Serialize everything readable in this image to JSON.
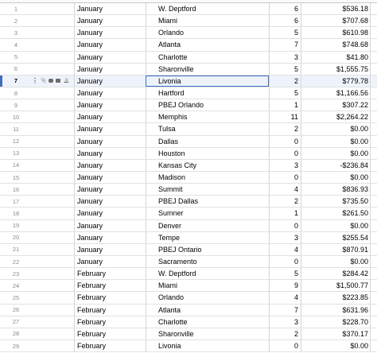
{
  "selected_row": 7,
  "rows": [
    {
      "n": "1",
      "month": "January",
      "city": "W. Deptford",
      "count": "6",
      "amount": "$536.18"
    },
    {
      "n": "2",
      "month": "January",
      "city": "Miami",
      "count": "6",
      "amount": "$707.68"
    },
    {
      "n": "3",
      "month": "January",
      "city": "Orlando",
      "count": "5",
      "amount": "$610.98"
    },
    {
      "n": "4",
      "month": "January",
      "city": "Atlanta",
      "count": "7",
      "amount": "$748.68"
    },
    {
      "n": "5",
      "month": "January",
      "city": "Charlotte",
      "count": "3",
      "amount": "$41.80"
    },
    {
      "n": "6",
      "month": "January",
      "city": "Sharonville",
      "count": "5",
      "amount": "$1,555.75"
    },
    {
      "n": "7",
      "month": "January",
      "city": "Livonia",
      "count": "2",
      "amount": "$779.78"
    },
    {
      "n": "8",
      "month": "January",
      "city": "Hartford",
      "count": "5",
      "amount": "$1,166.56"
    },
    {
      "n": "9",
      "month": "January",
      "city": "PBEJ Orlando",
      "count": "1",
      "amount": "$307.22"
    },
    {
      "n": "10",
      "month": "January",
      "city": "Memphis",
      "count": "11",
      "amount": "$2,264.22"
    },
    {
      "n": "11",
      "month": "January",
      "city": "Tulsa",
      "count": "2",
      "amount": "$0.00"
    },
    {
      "n": "12",
      "month": "January",
      "city": "Dallas",
      "count": "0",
      "amount": "$0.00"
    },
    {
      "n": "13",
      "month": "January",
      "city": "Houston",
      "count": "0",
      "amount": "$0.00"
    },
    {
      "n": "14",
      "month": "January",
      "city": "Kansas City",
      "count": "3",
      "amount": "-$236.84"
    },
    {
      "n": "15",
      "month": "January",
      "city": "Madison",
      "count": "0",
      "amount": "$0.00"
    },
    {
      "n": "16",
      "month": "January",
      "city": "Summit",
      "count": "4",
      "amount": "$836.93"
    },
    {
      "n": "17",
      "month": "January",
      "city": "PBEJ Dallas",
      "count": "2",
      "amount": "$735.50"
    },
    {
      "n": "18",
      "month": "January",
      "city": "Sumner",
      "count": "1",
      "amount": "$261.50"
    },
    {
      "n": "19",
      "month": "January",
      "city": "Denver",
      "count": "0",
      "amount": "$0.00"
    },
    {
      "n": "20",
      "month": "January",
      "city": "Tempe",
      "count": "3",
      "amount": "$255.54"
    },
    {
      "n": "21",
      "month": "January",
      "city": "PBEJ Ontario",
      "count": "4",
      "amount": "$870.91"
    },
    {
      "n": "22",
      "month": "January",
      "city": "Sacramento",
      "count": "0",
      "amount": "$0.00"
    },
    {
      "n": "23",
      "month": "February",
      "city": "W. Deptford",
      "count": "5",
      "amount": "$284.42"
    },
    {
      "n": "24",
      "month": "February",
      "city": "Miami",
      "count": "9",
      "amount": "$1,500.77"
    },
    {
      "n": "25",
      "month": "February",
      "city": "Orlando",
      "count": "4",
      "amount": "$223.85"
    },
    {
      "n": "26",
      "month": "February",
      "city": "Atlanta",
      "count": "7",
      "amount": "$631.96"
    },
    {
      "n": "27",
      "month": "February",
      "city": "Charlotte",
      "count": "3",
      "amount": "$228.70"
    },
    {
      "n": "28",
      "month": "February",
      "city": "Sharonville",
      "count": "2",
      "amount": "$370.17"
    },
    {
      "n": "29",
      "month": "February",
      "city": "Livonia",
      "count": "0",
      "amount": "$0.00"
    }
  ],
  "row_icons": [
    "more-dots-icon",
    "attachment-icon",
    "comment-icon",
    "briefcase-icon",
    "bell-icon"
  ],
  "colors": {
    "selection": "#3b6fc4",
    "selected_row_bg": "#eef3fb",
    "grid": "#e1e1e1"
  }
}
